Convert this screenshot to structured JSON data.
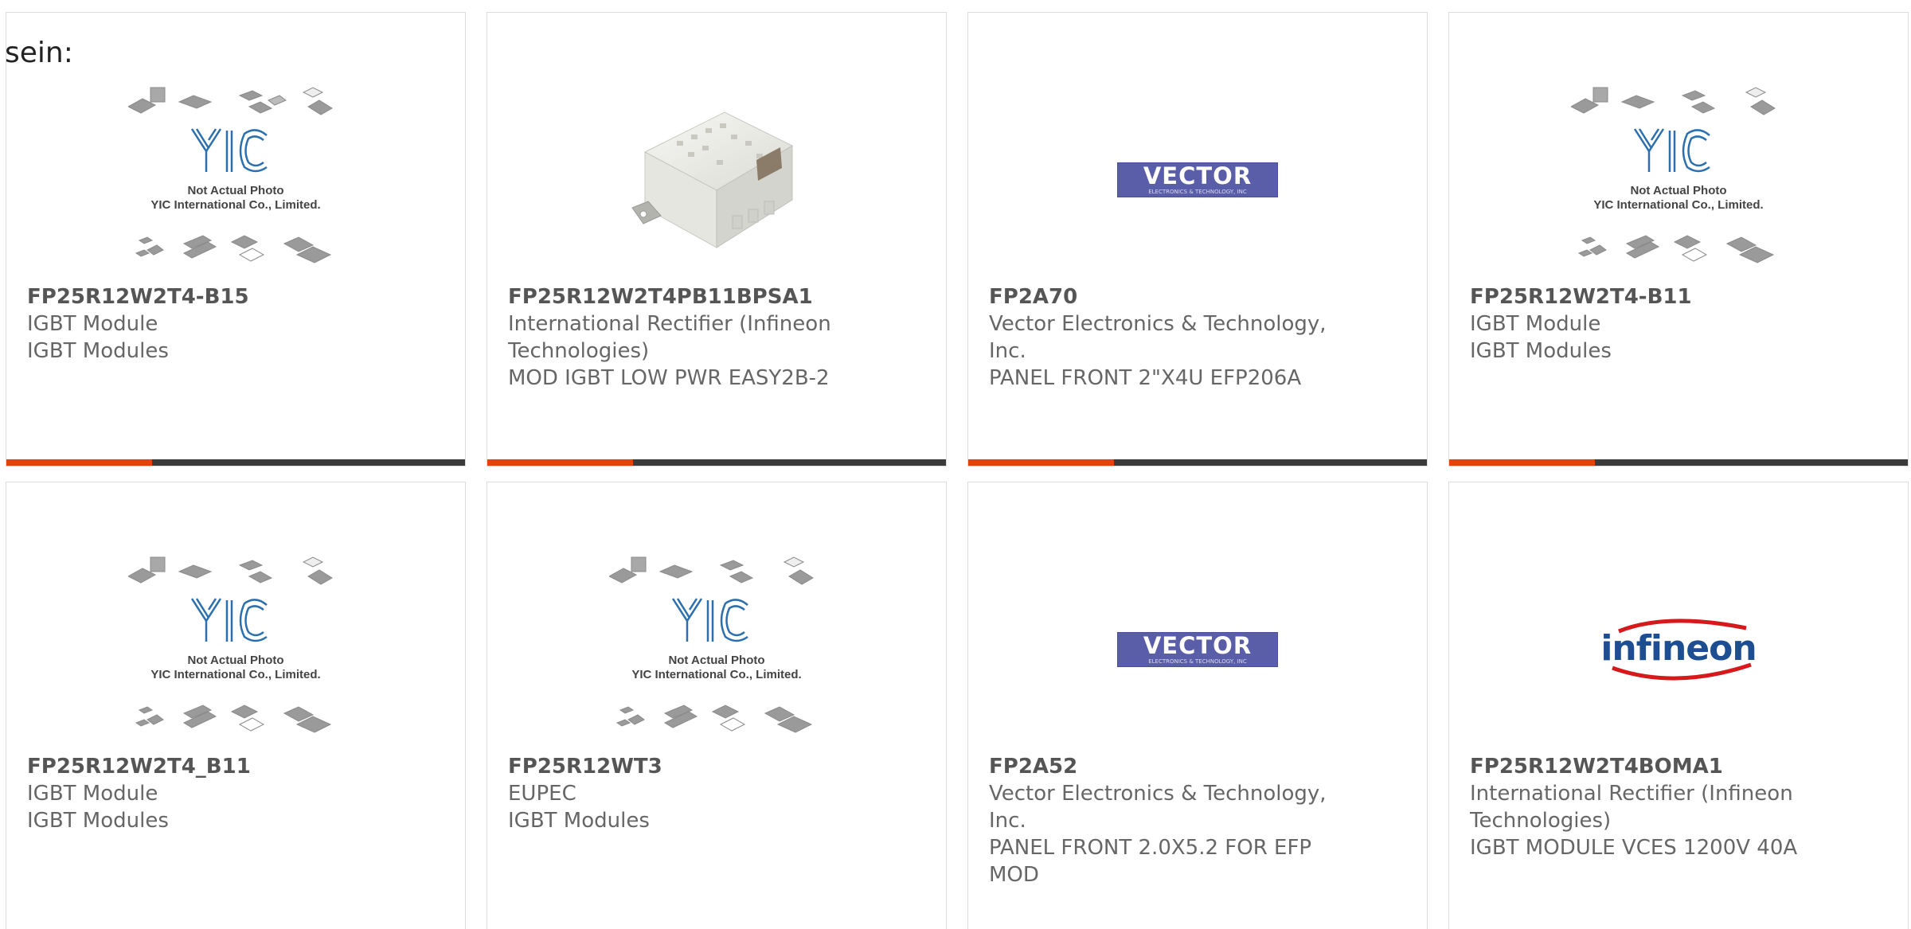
{
  "intro_text": "sein:",
  "placeholder": {
    "line1": "Not Actual Photo",
    "line2": "YIC International Co., Limited.",
    "logo_text": "YIC"
  },
  "logos": {
    "vector_main": "VECTOR",
    "vector_sub": "ELECTRONICS & TECHNOLOGY, INC",
    "infineon": "infineon"
  },
  "colors": {
    "accent": "#e8400c",
    "bar": "#3b3b3b",
    "text": "#666666",
    "yic_blue": "#2b6fae"
  },
  "products": [
    {
      "part": "FP25R12W2T4-B15",
      "lines": [
        "IGBT Module",
        "IGBT Modules"
      ],
      "image": "yic-placeholder"
    },
    {
      "part": "FP25R12W2T4PB11BPSA1",
      "lines": [
        "International Rectifier (Infineon",
        "Technologies)",
        "MOD IGBT LOW PWR EASY2B-2"
      ],
      "image": "module-photo"
    },
    {
      "part": "FP2A70",
      "lines": [
        "Vector Electronics & Technology,",
        "Inc.",
        "PANEL FRONT 2\"X4U EFP206A"
      ],
      "image": "vector-logo"
    },
    {
      "part": "FP25R12W2T4-B11",
      "lines": [
        "IGBT Module",
        "IGBT Modules"
      ],
      "image": "yic-placeholder"
    },
    {
      "part": "FP25R12W2T4_B11",
      "lines": [
        "IGBT Module",
        "IGBT Modules"
      ],
      "image": "yic-placeholder"
    },
    {
      "part": "FP25R12WT3",
      "lines": [
        "EUPEC",
        "IGBT Modules"
      ],
      "image": "yic-placeholder"
    },
    {
      "part": "FP2A52",
      "lines": [
        "Vector Electronics & Technology,",
        "Inc.",
        "PANEL FRONT 2.0X5.2 FOR EFP",
        "MOD"
      ],
      "image": "vector-logo"
    },
    {
      "part": "FP25R12W2T4BOMA1",
      "lines": [
        "International Rectifier (Infineon",
        "Technologies)",
        "IGBT MODULE VCES 1200V 40A"
      ],
      "image": "infineon-logo"
    }
  ]
}
